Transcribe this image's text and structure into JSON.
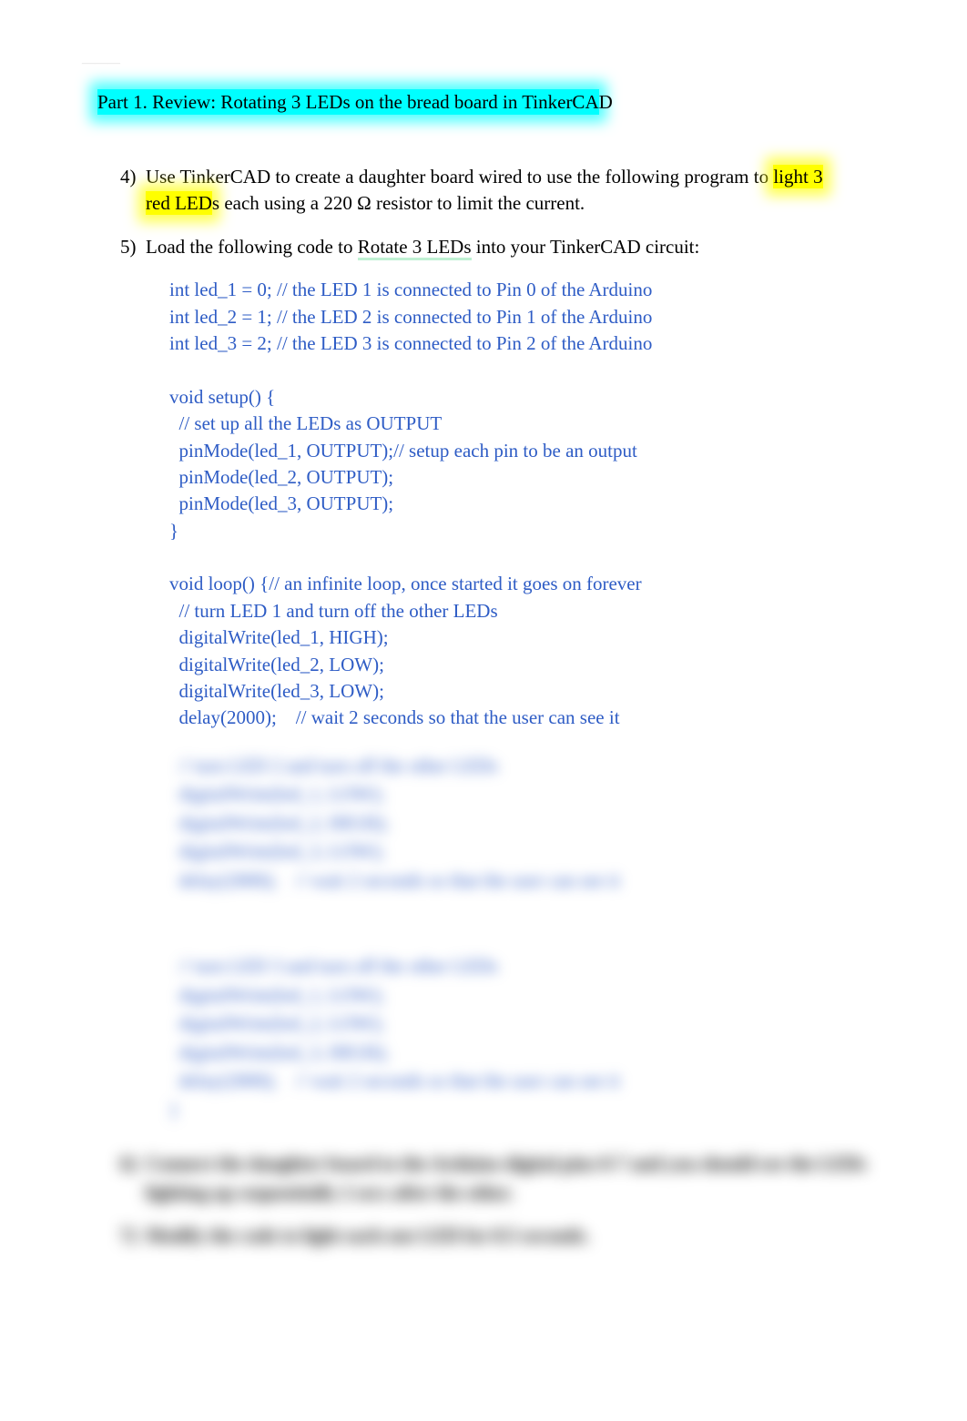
{
  "faded_top": "———",
  "heading": {
    "highlighted": "Part 1. Review: Rotating 3 LEDs on the bread board in TinkerCA",
    "trailing": "D"
  },
  "items": {
    "four": {
      "marker": "4)",
      "pre": "Use TinkerCAD to create a daughter board wired to use the following program to ",
      "hl1": "light 3",
      "mid_break": " ",
      "hl2": "red LED",
      "post": "s each using a 220 Ω resistor to limit the current."
    },
    "five": {
      "marker": "5)",
      "pre": "Load the following code to ",
      "underlined": "Rotate 3 LEDs",
      "post": " into your TinkerCAD circuit:"
    }
  },
  "code": {
    "l1": "int led_1 = 0; // the LED 1 is connected to Pin 0 of the Arduino",
    "l2": "int led_2 = 1; // the LED 2 is connected to Pin 1 of the Arduino",
    "l3": "int led_3 = 2; // the LED 3 is connected to Pin 2 of the Arduino",
    "l4": "",
    "l5": "void setup() {",
    "l6": "  // set up all the LEDs as OUTPUT",
    "l7": "  pinMode(led_1, OUTPUT);// setup each pin to be an output",
    "l8": "  pinMode(led_2, OUTPUT);",
    "l9": "  pinMode(led_3, OUTPUT);",
    "l10": "}",
    "l11": "",
    "l12": "void loop() {// an infinite loop, once started it goes on forever",
    "l13": "  // turn LED 1 and turn off the other LEDs",
    "l14": "  digitalWrite(led_1, HIGH);",
    "l15": "  digitalWrite(led_2, LOW);",
    "l16": "  digitalWrite(led_3, LOW);",
    "l17": "  delay(2000);    // wait 2 seconds so that the user can see it"
  },
  "blurred_code": {
    "b1": "  // turn LED 2 and turn off the other LEDs",
    "b2": "  digitalWrite(led_1, LOW);",
    "b3": "  digitalWrite(led_2, HIGH);",
    "b4": "  digitalWrite(led_3, LOW);",
    "b5": "  delay(2000);    // wait 2 seconds so that the user can see it",
    "b6": "",
    "b7": "",
    "b8": "  // turn LED 3 and turn off the other LEDs",
    "b9": "  digitalWrite(led_1, LOW);",
    "b10": "  digitalWrite(led_2, LOW);",
    "b11": "  digitalWrite(led_3, HIGH);",
    "b12": "  delay(2000);    // wait 2 seconds so that the user can see it",
    "b13": "}"
  },
  "blurred_items": {
    "six": {
      "marker": "6)",
      "text": "Connect the daughter board to the Arduino digital pins 0-7 and you should see the LEDs lighting up sequentially 2 secs after the other."
    },
    "seven": {
      "marker": "7)",
      "text": "Modify the code to light each one LED for 0.5 seconds."
    }
  }
}
